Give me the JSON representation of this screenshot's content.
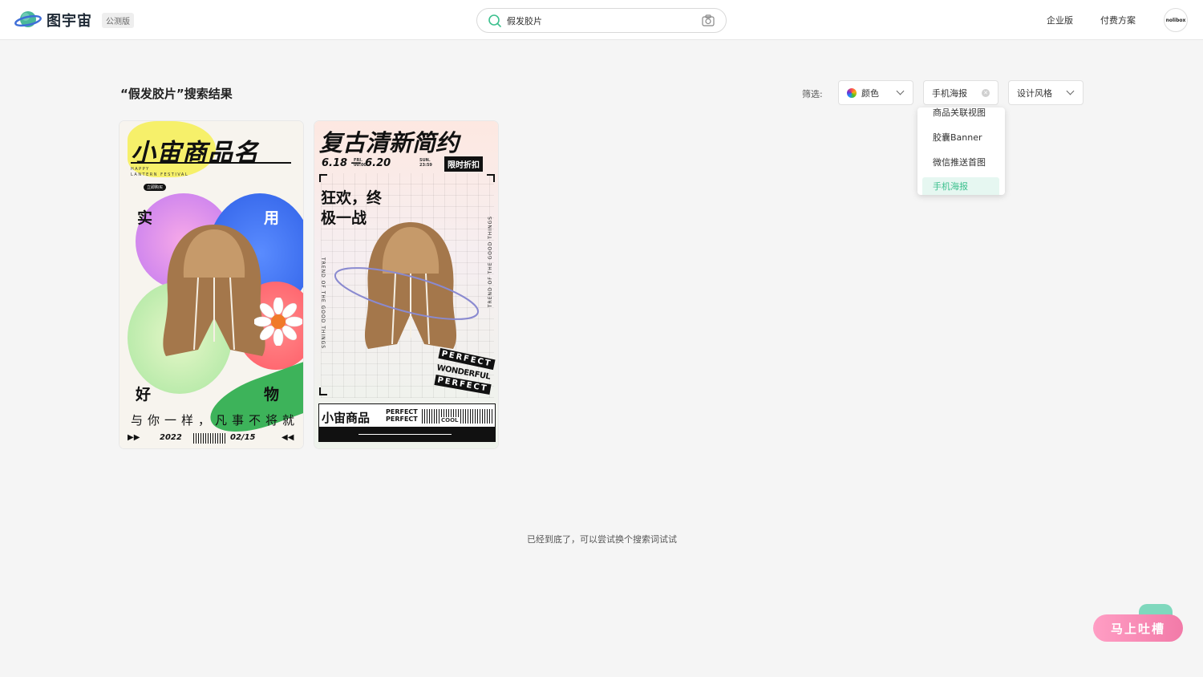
{
  "header": {
    "logo_text": "图宇宙",
    "beta_badge": "公测版",
    "search_value": "假发胶片",
    "nav": [
      "企业版",
      "付费方案"
    ],
    "avatar_text": "nolibox"
  },
  "results": {
    "title": "“假发胶片”搜索结果",
    "filter_label": "筛选:",
    "filters": {
      "color": "颜色",
      "scene": "手机海报",
      "style": "设计风格"
    },
    "dropdown_items": [
      "商品关联视图",
      "胶囊Banner",
      "微信推送首图",
      "手机海报"
    ],
    "dropdown_active": "手机海报"
  },
  "cards": [
    {
      "title": "小宙商品名",
      "subtitle_1": "HAPPY",
      "subtitle_2": "LANTERN FESTIVAL",
      "button": "立即购买",
      "chars": [
        "实",
        "用",
        "好",
        "物"
      ],
      "slogan": "与你一样，凡事不将就",
      "footer_left": "2022",
      "footer_right": "02/15"
    },
    {
      "title": "复古清新简约",
      "date": "6.18 — 6.20",
      "date_small_1": "FRI.",
      "date_small_2": "00:00",
      "date_small_3": "SUN.",
      "date_small_4": "23:59",
      "tag": "限时折扣",
      "headline_1": "狂欢，终",
      "headline_2": "极一战",
      "vertical": "TREND OF THE GOOD THINGS",
      "perfect_1": "PERFECT",
      "perfect_2": "WONDERFUL",
      "perfect_3": "PERFECT",
      "footer_title": "小宙商品",
      "footer_small": "PERFECT",
      "footer_cool": "COOL"
    }
  ],
  "end_text": "已经到底了，可以尝试换个搜索词试试",
  "feedback": "马上吐槽",
  "colors": {
    "accent": "#3cc08e",
    "feedback": "#f27aa8"
  }
}
